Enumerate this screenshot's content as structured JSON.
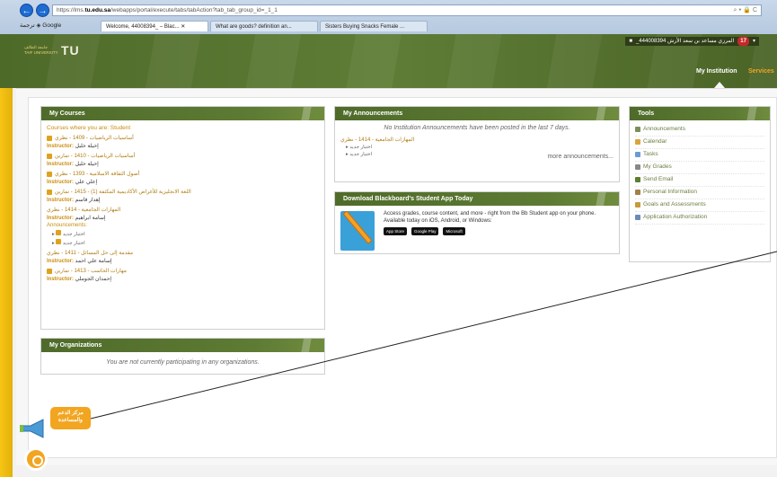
{
  "browser": {
    "url_prefix": "https://lms.",
    "url_domain": "tu.edu.sa",
    "url_path": "/webapps/portal/execute/tabs/tabAction?tab_tab_group_id=_1_1",
    "toolbar_search": "Google",
    "toolbar_translate": "ترجمة",
    "tabs": [
      "Welcome, 44008394_ – Blac...",
      "What are goods? definition an...",
      "Sisters Buying Snacks Female ..."
    ]
  },
  "header": {
    "uni_logo_lines": [
      "جامعة الطائف",
      "TAIF UNIVERSITY"
    ],
    "tu_logo": "TU",
    "user_name": "_444008394 المرزي مساعد بن سعد الأرش",
    "notif_count": "17",
    "tabs": {
      "my_institution": "My Institution",
      "services": "Services"
    }
  },
  "my_courses": {
    "title": "My Courses",
    "subtitle": "Courses where you are: Student",
    "instructor_label": "Instructor:",
    "courses": [
      {
        "title": "أساسيات الرياضيات - 1409 - نظري",
        "instructor": "إخيلة خليل"
      },
      {
        "title": "أساسيات الرياضيات - 1410 - تمارين",
        "instructor": "إخيلة خليل"
      },
      {
        "title": "أصول الثقافة الاسلامية - 1393 - نظري",
        "instructor": "إعلي علي"
      },
      {
        "title": "اللغة الانجليزية للأغراض الأكاديمية المكثفة (1) - 1415 - تمارين",
        "instructor": "إهدار قاسم"
      },
      {
        "title": "المهارات الجامعية - 1414 - نظري",
        "instructor": "إسامة ابراهيم"
      },
      {
        "title": "مقدمة إلى حل المسائل - 1411 - نظري",
        "instructor": "إسامة علي احمد"
      },
      {
        "title": "مهارات الحاسب - 1413 - تمارين",
        "instructor": "إحمدان الجوملي"
      }
    ],
    "announcements_label": "Announcements:",
    "announcements": [
      "اختبار جديد",
      "اختبار جديد"
    ]
  },
  "my_organizations": {
    "title": "My Organizations",
    "empty_text": "You are not currently participating in any organizations."
  },
  "my_announcements": {
    "title": "My Announcements",
    "empty_text": "No Institution Announcements have been posted in the last 7 days.",
    "course_link": "المهارات الجامعية - 1414 - نظري",
    "items": [
      "اختبار جديد",
      "اختبار جديد"
    ],
    "more_link": "more announcements..."
  },
  "download_app": {
    "title": "Download Blackboard's Student App Today",
    "description": "Access grades, course content, and more - right from the Bb Student app on your phone. Available today on iOS, Android, or Windows:",
    "badges": [
      "App Store",
      "Google Play",
      "Microsoft"
    ]
  },
  "tools": {
    "title": "Tools",
    "items": [
      {
        "label": "Announcements",
        "icon": "megaphone-icon",
        "color": "#7a8f5a"
      },
      {
        "label": "Calendar",
        "icon": "calendar-icon",
        "color": "#d9a53a"
      },
      {
        "label": "Tasks",
        "icon": "tasks-icon",
        "color": "#6a9bd1"
      },
      {
        "label": "My Grades",
        "icon": "grades-icon",
        "color": "#888888"
      },
      {
        "label": "Send Email",
        "icon": "email-icon",
        "color": "#5b7f2e"
      },
      {
        "label": "Personal Information",
        "icon": "person-icon",
        "color": "#a57f4b"
      },
      {
        "label": "Goals and Assessments",
        "icon": "goals-icon",
        "color": "#c79a3c"
      },
      {
        "label": "Application Authorization",
        "icon": "app-auth-icon",
        "color": "#6c8ab8"
      }
    ]
  },
  "help": {
    "bubble_lines": [
      "مركز الدعم",
      "والمساعدة"
    ]
  }
}
